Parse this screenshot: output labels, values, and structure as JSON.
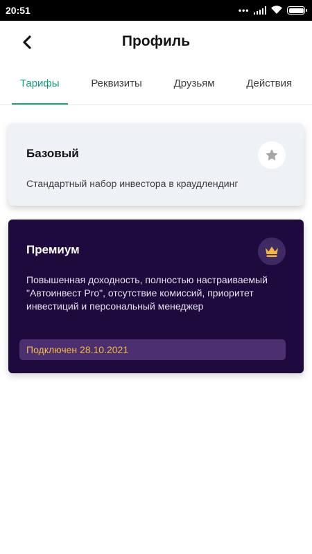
{
  "status_bar": {
    "time": "20:51",
    "dots": "•••"
  },
  "header": {
    "title": "Профиль",
    "back_icon": "chevron-left-icon"
  },
  "tabs": [
    {
      "label": "Тарифы",
      "active": true
    },
    {
      "label": "Реквизиты",
      "active": false
    },
    {
      "label": "Друзьям",
      "active": false
    },
    {
      "label": "Действия",
      "active": false
    }
  ],
  "plans": {
    "basic": {
      "title": "Базовый",
      "description": "Стандартный набор инвестора в краудлендинг",
      "icon": "star-icon"
    },
    "premium": {
      "title": "Премиум",
      "description": "Повышенная доходность, полностью настраиваемый \"Автоинвест Pro\", отсутствие комиссий, приоритет инвестиций и персональный менеджер",
      "icon": "crown-icon",
      "status": "Подключен 28.10.2021"
    }
  },
  "colors": {
    "accent": "#129b7a",
    "premium_bg": "#1e0a3c",
    "basic_bg": "#eef2f7",
    "badge_text": "#f4b647"
  }
}
